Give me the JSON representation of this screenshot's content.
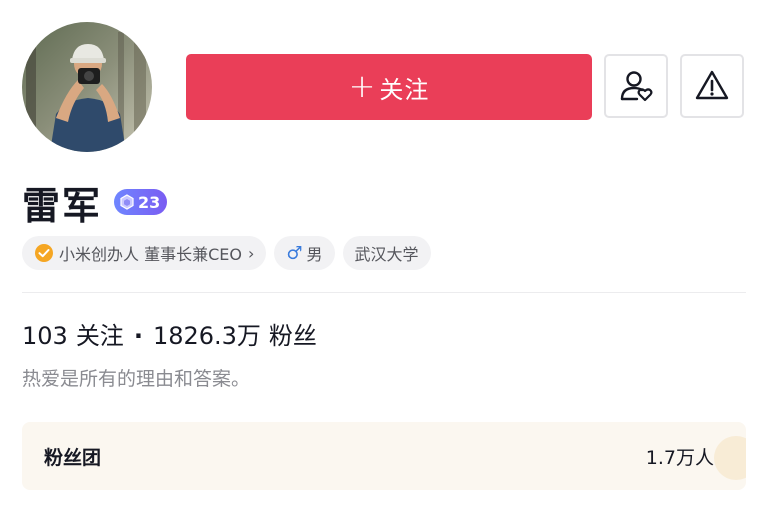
{
  "profile": {
    "name": "雷军",
    "level": "23",
    "avatar_icon": "user-avatar-photo"
  },
  "actions": {
    "follow_plus": "+",
    "follow_label": "关注",
    "follow_color": "#ea3e58",
    "friend_icon": "user-heart-icon",
    "report_icon": "warning-triangle-icon"
  },
  "tags": {
    "verified": {
      "icon": "verified-check-icon",
      "label": "小米创办人 董事长兼CEO",
      "chevron": "›"
    },
    "gender": {
      "icon": "male-symbol-icon",
      "symbol": "♂",
      "label": "男"
    },
    "school": {
      "label": "武汉大学"
    }
  },
  "stats": {
    "following_count": "103",
    "following_label": "关注",
    "separator": "·",
    "followers_count": "1826.3万",
    "followers_label": "粉丝"
  },
  "bio": "热爱是所有的理由和答案。",
  "fan_group": {
    "label": "粉丝团",
    "count": "1.7万人"
  }
}
